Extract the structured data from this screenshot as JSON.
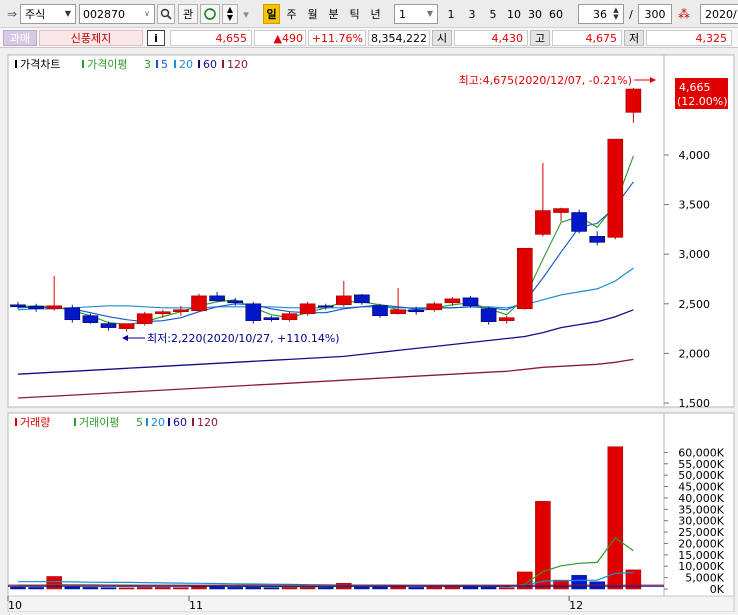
{
  "toolbar": {
    "market": "주식",
    "code": "002870",
    "btn_gwan": "관",
    "periods": [
      "일",
      "주",
      "월",
      "분",
      "틱",
      "년"
    ],
    "interval_select": "1",
    "interval_buttons": [
      "1",
      "3",
      "5",
      "10",
      "30",
      "60"
    ],
    "count_value": "36",
    "separator": "/",
    "total_value": "300",
    "date_value": "2020/"
  },
  "quote_bar": {
    "tag": "과매",
    "status": "신풍제지",
    "info": "i",
    "price": "4,655",
    "change": "▲490",
    "change_pct": "+11.76%",
    "volume": "8,354,222",
    "open_label": "시",
    "open_value": "4,430",
    "high_label": "고",
    "high_value": "4,675",
    "low_label": "저",
    "low_value": "4,325"
  },
  "price_panel": {
    "title": "가격차트",
    "ma_label": "가격이평",
    "ma_periods": [
      "3",
      "5",
      "20",
      "60",
      "120"
    ],
    "high_note": "최고:4,675(2020/12/07, -0.21%)",
    "low_note": "최저:2,220(2020/10/27, +110.14%)",
    "current_price": "4,665",
    "current_pct": "(12.00%)",
    "y_ticks": [
      "4,000",
      "3,500",
      "3,000",
      "2,500",
      "2,000",
      "1,500"
    ]
  },
  "volume_panel": {
    "title": "거래량",
    "ma_label": "거래이평",
    "ma_periods": [
      "5",
      "20",
      "60",
      "120"
    ],
    "y_ticks": [
      "60,000K",
      "55,000K",
      "50,000K",
      "45,000K",
      "40,000K",
      "35,000K",
      "30,000K",
      "25,000K",
      "20,000K",
      "15,000K",
      "10,000K",
      "5,000K",
      "0K"
    ]
  },
  "x_axis": {
    "labels": [
      "10",
      "11",
      "12"
    ]
  },
  "colors": {
    "up": "#e00000",
    "down": "#0018c8",
    "ma3": "#2d9a2d",
    "ma5": "#1458c8",
    "ma20": "#1a8fd0",
    "ma60": "#10108a",
    "ma120": "#8a1a40"
  },
  "chart_data": {
    "type": "candlestick",
    "ohlc": [
      {
        "o": 2490,
        "h": 2520,
        "l": 2450,
        "c": 2470
      },
      {
        "o": 2475,
        "h": 2500,
        "l": 2420,
        "c": 2450
      },
      {
        "o": 2450,
        "h": 2780,
        "l": 2430,
        "c": 2480
      },
      {
        "o": 2460,
        "h": 2490,
        "l": 2310,
        "c": 2340
      },
      {
        "o": 2380,
        "h": 2400,
        "l": 2300,
        "c": 2310
      },
      {
        "o": 2300,
        "h": 2320,
        "l": 2230,
        "c": 2260
      },
      {
        "o": 2250,
        "h": 2300,
        "l": 2220,
        "c": 2300
      },
      {
        "o": 2300,
        "h": 2420,
        "l": 2280,
        "c": 2400
      },
      {
        "o": 2400,
        "h": 2440,
        "l": 2360,
        "c": 2420
      },
      {
        "o": 2420,
        "h": 2480,
        "l": 2380,
        "c": 2440
      },
      {
        "o": 2430,
        "h": 2600,
        "l": 2420,
        "c": 2580
      },
      {
        "o": 2580,
        "h": 2620,
        "l": 2520,
        "c": 2530
      },
      {
        "o": 2530,
        "h": 2560,
        "l": 2480,
        "c": 2510
      },
      {
        "o": 2500,
        "h": 2520,
        "l": 2300,
        "c": 2330
      },
      {
        "o": 2360,
        "h": 2380,
        "l": 2320,
        "c": 2340
      },
      {
        "o": 2340,
        "h": 2420,
        "l": 2320,
        "c": 2400
      },
      {
        "o": 2400,
        "h": 2520,
        "l": 2380,
        "c": 2500
      },
      {
        "o": 2480,
        "h": 2500,
        "l": 2440,
        "c": 2470
      },
      {
        "o": 2490,
        "h": 2730,
        "l": 2470,
        "c": 2580
      },
      {
        "o": 2590,
        "h": 2600,
        "l": 2490,
        "c": 2510
      },
      {
        "o": 2480,
        "h": 2500,
        "l": 2360,
        "c": 2380
      },
      {
        "o": 2400,
        "h": 2660,
        "l": 2390,
        "c": 2440
      },
      {
        "o": 2440,
        "h": 2470,
        "l": 2390,
        "c": 2420
      },
      {
        "o": 2440,
        "h": 2520,
        "l": 2420,
        "c": 2500
      },
      {
        "o": 2510,
        "h": 2570,
        "l": 2480,
        "c": 2550
      },
      {
        "o": 2560,
        "h": 2580,
        "l": 2460,
        "c": 2480
      },
      {
        "o": 2450,
        "h": 2470,
        "l": 2290,
        "c": 2320
      },
      {
        "o": 2330,
        "h": 2380,
        "l": 2300,
        "c": 2360
      },
      {
        "o": 2450,
        "h": 3060,
        "l": 2440,
        "c": 3060
      },
      {
        "o": 3200,
        "h": 3920,
        "l": 3180,
        "c": 3440
      },
      {
        "o": 3420,
        "h": 3470,
        "l": 3330,
        "c": 3460
      },
      {
        "o": 3420,
        "h": 3450,
        "l": 3210,
        "c": 3230
      },
      {
        "o": 3180,
        "h": 3230,
        "l": 3090,
        "c": 3120
      },
      {
        "o": 3170,
        "h": 4130,
        "l": 3150,
        "c": 4160
      },
      {
        "o": 4430,
        "h": 4675,
        "l": 4325,
        "c": 4665
      }
    ],
    "ma3": [
      2470,
      2480,
      2470,
      2430,
      2380,
      2310,
      2290,
      2320,
      2370,
      2420,
      2480,
      2520,
      2540,
      2460,
      2390,
      2360,
      2410,
      2460,
      2520,
      2520,
      2490,
      2440,
      2420,
      2460,
      2490,
      2510,
      2450,
      2390,
      2560,
      2950,
      3320,
      3380,
      3270,
      3500,
      3990
    ],
    "ma5": [
      2460,
      2470,
      2460,
      2450,
      2410,
      2370,
      2340,
      2320,
      2330,
      2360,
      2420,
      2470,
      2500,
      2490,
      2450,
      2420,
      2410,
      2410,
      2450,
      2470,
      2490,
      2470,
      2450,
      2460,
      2460,
      2470,
      2460,
      2440,
      2520,
      2760,
      3020,
      3270,
      3310,
      3480,
      3730
    ],
    "ma20": [
      2440,
      2450,
      2450,
      2460,
      2470,
      2480,
      2480,
      2470,
      2460,
      2460,
      2460,
      2470,
      2470,
      2470,
      2470,
      2460,
      2460,
      2460,
      2460,
      2470,
      2470,
      2460,
      2460,
      2460,
      2460,
      2470,
      2470,
      2460,
      2490,
      2540,
      2590,
      2620,
      2650,
      2730,
      2860
    ],
    "ma60": [
      1790,
      1800,
      1810,
      1820,
      1830,
      1840,
      1850,
      1860,
      1870,
      1880,
      1890,
      1900,
      1910,
      1920,
      1930,
      1940,
      1950,
      1960,
      1970,
      1990,
      2010,
      2030,
      2050,
      2070,
      2090,
      2110,
      2130,
      2150,
      2170,
      2210,
      2260,
      2290,
      2320,
      2370,
      2440
    ],
    "ma120": [
      1550,
      1560,
      1570,
      1580,
      1590,
      1600,
      1610,
      1620,
      1630,
      1640,
      1650,
      1660,
      1670,
      1680,
      1690,
      1700,
      1710,
      1720,
      1730,
      1740,
      1750,
      1760,
      1770,
      1780,
      1790,
      1800,
      1810,
      1820,
      1840,
      1860,
      1870,
      1880,
      1890,
      1910,
      1940
    ],
    "volume": [
      800,
      700,
      5500,
      900,
      700,
      600,
      500,
      700,
      700,
      600,
      1200,
      1100,
      700,
      800,
      600,
      700,
      900,
      800,
      2500,
      1200,
      900,
      1500,
      700,
      900,
      1200,
      1100,
      800,
      600,
      7500,
      38500,
      3900,
      6000,
      3200,
      62500,
      8400
    ],
    "volume_ma5": [
      1700,
      1600,
      1900,
      1800,
      1800,
      1700,
      1600,
      1500,
      1500,
      1400,
      1300,
      1300,
      1200,
      1100,
      1100,
      1000,
      1000,
      1000,
      1200,
      1200,
      1200,
      1300,
      1300,
      1300,
      1200,
      1200,
      1200,
      1000,
      2100,
      7700,
      10200,
      11300,
      11700,
      22500,
      16800
    ],
    "volume_ma20": [
      3200,
      3200,
      3200,
      3100,
      3000,
      2900,
      2900,
      2800,
      2700,
      2600,
      2500,
      2400,
      2300,
      2200,
      2100,
      2000,
      1900,
      1800,
      1700,
      1700,
      1700,
      1600,
      1500,
      1500,
      1500,
      1400,
      1400,
      1300,
      1600,
      3500,
      3600,
      3800,
      3900,
      6900,
      7200
    ],
    "volume_ylim": [
      0,
      65000
    ]
  }
}
